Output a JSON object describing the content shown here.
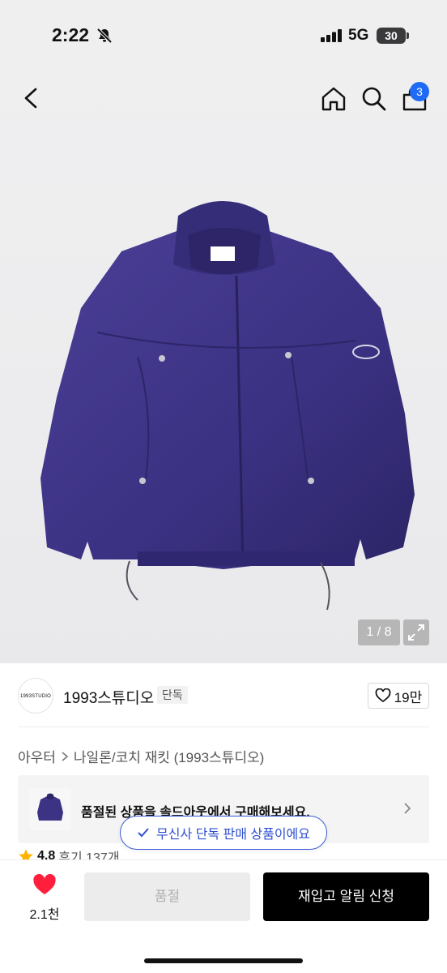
{
  "status_bar": {
    "time": "2:22",
    "network": "5G",
    "battery": "30"
  },
  "nav": {
    "cart_count": "3"
  },
  "gallery": {
    "pager": "1 / 8"
  },
  "brand": {
    "logo_text": "1993STUDIO",
    "name": "1993스튜디오",
    "tag": "단독",
    "likes": "19만"
  },
  "breadcrumb": {
    "category": "아우터",
    "path": "나일론/코치 재킷 (1993스튜디오)"
  },
  "soldout_banner": {
    "text": "품절된 상품을 솔드아웃에서 구매해보세요."
  },
  "rating": {
    "score": "4.8",
    "reviews": "후기 137개"
  },
  "toast": {
    "text": "무신사 단독 판매 상품이에요"
  },
  "bottom_bar": {
    "wish_count": "2.1천",
    "soldout_label": "품절",
    "restock_label": "재입고 알림 신청"
  },
  "colors": {
    "accent_blue": "#1f6bf5",
    "toast_blue": "#3b5bd9",
    "heart_red": "#ff1f3c",
    "jacket": "#3d3384"
  }
}
